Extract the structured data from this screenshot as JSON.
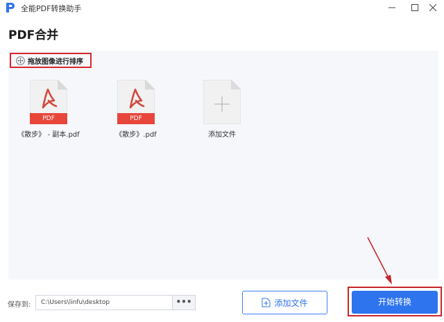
{
  "window": {
    "title": "全能PDF转换助手",
    "icons": {
      "logo": "app-logo-icon",
      "minimize": "minimize-icon",
      "maximize": "maximize-icon",
      "close": "close-icon"
    }
  },
  "page": {
    "title": "PDF合并"
  },
  "sort_hint": {
    "label": "拖放图像进行排序",
    "icon": "move-arrows-icon"
  },
  "files": [
    {
      "name": "《散步》 - 副本.pdf",
      "badge": "PDF"
    },
    {
      "name": "《散步》.pdf",
      "badge": "PDF"
    }
  ],
  "add_tile": {
    "label": "添加文件",
    "icon": "plus-icon"
  },
  "footer": {
    "save_label": "保存到:",
    "save_path": "C:\\Users\\linfu\\desktop",
    "browse_label": "•••",
    "add_file_label": "添加文件",
    "start_label": "开始转换"
  },
  "colors": {
    "accent": "#2f74ef",
    "pdf_red": "#e8463b",
    "highlight_red": "#c8262c",
    "workspace_bg": "#f5f7fb"
  }
}
